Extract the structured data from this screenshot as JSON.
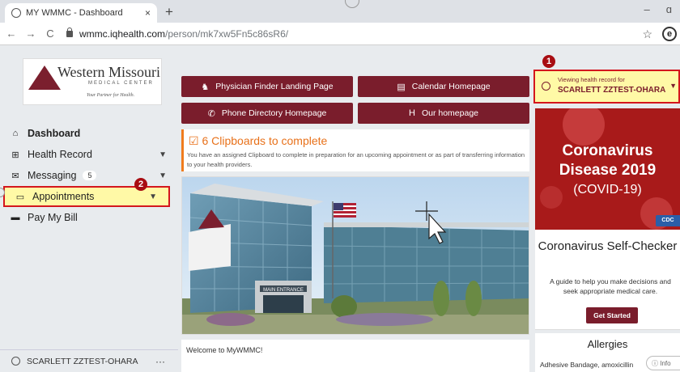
{
  "browser": {
    "tab_title": "MY WMMC - Dashboard",
    "tab_close": "×",
    "new_tab": "+",
    "url_host": "wmmc.iqhealth.com",
    "url_path": "/person/mk7xw5Fn5c86sR6/",
    "window_controls": [
      "–",
      "ɑ"
    ]
  },
  "logo": {
    "name": "Western Missouri",
    "subtitle": "MEDICAL CENTER",
    "tagline": "Your Partner for Health."
  },
  "sidebar": {
    "items": [
      {
        "label": "Dashboard",
        "icon": "home-icon"
      },
      {
        "label": "Health Record",
        "icon": "medical-record-icon"
      },
      {
        "label": "Messaging",
        "icon": "envelope-icon",
        "badge": "5"
      },
      {
        "label": "Appointments",
        "icon": "calendar-icon"
      },
      {
        "label": "Pay My Bill",
        "icon": "credit-card-icon"
      }
    ],
    "user_name": "SCARLETT ZZTEST-OHARA",
    "more": "···"
  },
  "markers": [
    "1",
    "2"
  ],
  "quick_links": [
    {
      "label": "Physician Finder Landing Page",
      "icon": "physician-icon"
    },
    {
      "label": "Calendar Homepage",
      "icon": "calendar-icon"
    },
    {
      "label": "Phone Directory Homepage",
      "icon": "phone-icon"
    },
    {
      "label": "Our homepage",
      "icon": "hospital-icon"
    }
  ],
  "clipboards": {
    "title": "6 Clipboards to complete",
    "description": "You have an assigned Clipboard to complete in preparation for an upcoming appointment or as part of transferring information to your health providers."
  },
  "photo": {
    "entrance_sign": "MAIN ENTRANCE"
  },
  "welcome": "Welcome to MyWMMC!",
  "health_record": {
    "label": "Viewing health record for",
    "name": "SCARLETT ZZTEST-OHARA"
  },
  "covid_banner": {
    "line1": "Coronavirus",
    "line2": "Disease 2019",
    "line3": "(COVID-19)",
    "logo_text": "CDC"
  },
  "self_checker": {
    "title": "Coronavirus Self-Checker",
    "description": "A guide to help you make decisions and seek appropriate medical care.",
    "button": "Get Started"
  },
  "allergies": {
    "title": "Allergies",
    "value": "Adhesive Bandage, amoxicillin"
  },
  "info_button": "ⓘ Info"
}
